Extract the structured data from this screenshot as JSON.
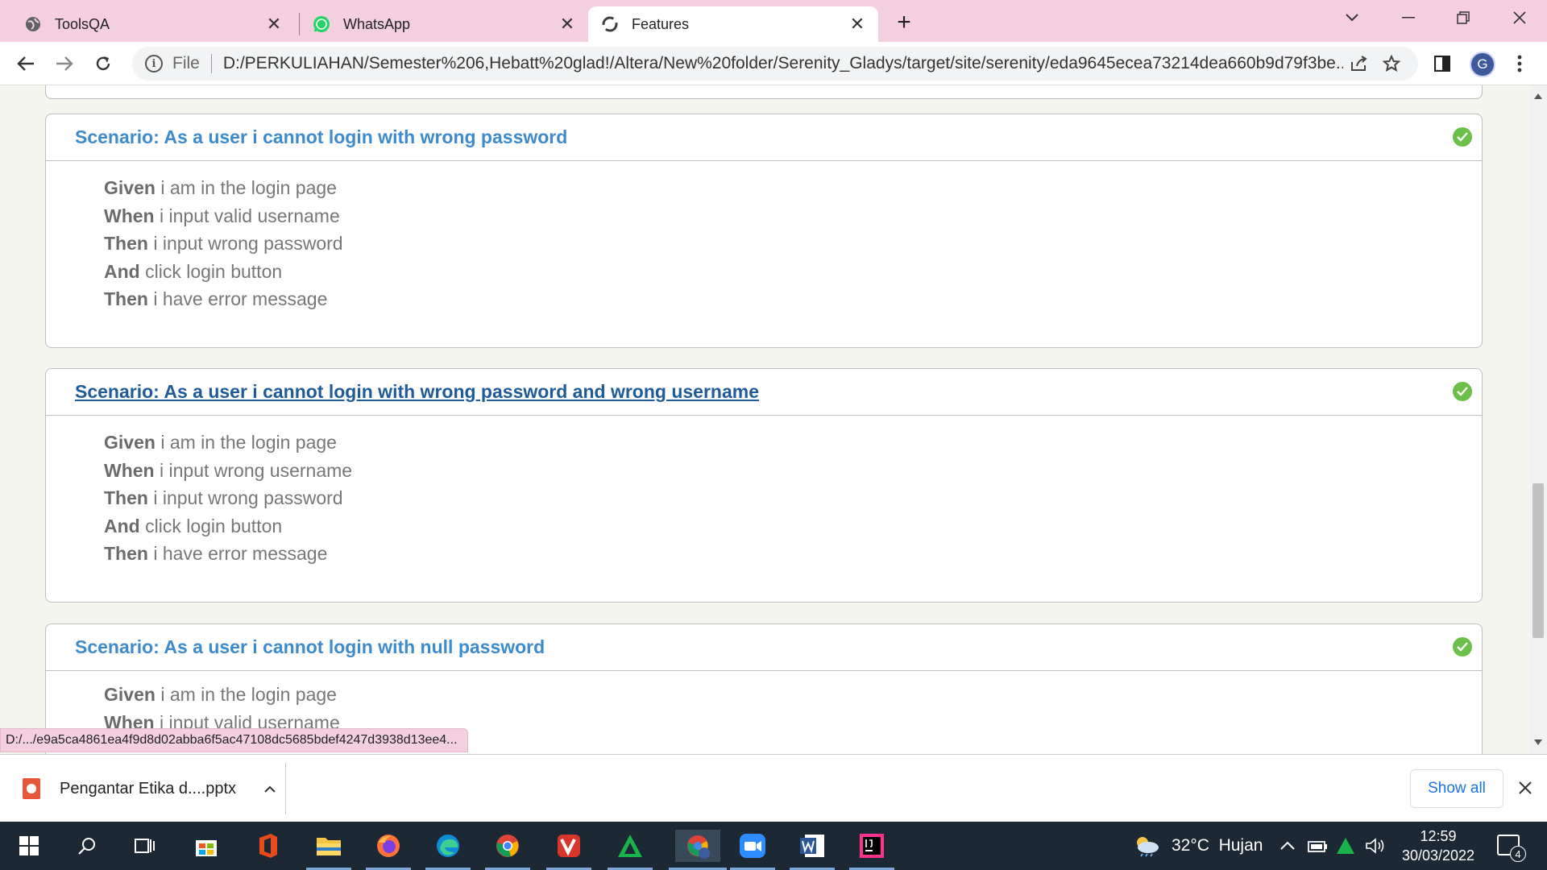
{
  "browser": {
    "tabs": [
      {
        "title": "ToolsQA",
        "icon": "globe-icon"
      },
      {
        "title": "WhatsApp",
        "icon": "whatsapp-icon"
      },
      {
        "title": "Features",
        "icon": "loading-icon",
        "active": true
      }
    ],
    "address": {
      "scheme": "File",
      "url": "D:/PERKULIAHAN/Semester%206,Hebatt%20glad!/Altera/New%20folder/Serenity_Gladys/target/site/serenity/eda9645ecea73214dea660b9d79f3be..."
    },
    "profile_initial": "G",
    "status_url": "D:/.../e9a5ca4861ea4f9d8d02abba6f5ac47108dc5685bdef4247d3938d13ee4..."
  },
  "scenarios": [
    {
      "title": "Scenario: As a user i cannot login with wrong password",
      "status": "passed",
      "steps": [
        {
          "keyword": "Given",
          "text": "i am in the login page"
        },
        {
          "keyword": "When",
          "text": "i input valid username"
        },
        {
          "keyword": "Then",
          "text": "i input wrong password"
        },
        {
          "keyword": "And",
          "text": "click login button"
        },
        {
          "keyword": "Then",
          "text": "i have error message"
        }
      ]
    },
    {
      "title": "Scenario: As a user i cannot login with wrong password and wrong username",
      "status": "passed",
      "steps": [
        {
          "keyword": "Given",
          "text": "i am in the login page"
        },
        {
          "keyword": "When",
          "text": "i input wrong username"
        },
        {
          "keyword": "Then",
          "text": "i input wrong password"
        },
        {
          "keyword": "And",
          "text": "click login button"
        },
        {
          "keyword": "Then",
          "text": "i have error message"
        }
      ]
    },
    {
      "title": "Scenario: As a user i cannot login with null password",
      "status": "passed",
      "steps": [
        {
          "keyword": "Given",
          "text": "i am in the login page"
        },
        {
          "keyword": "When",
          "text": "i input valid username"
        }
      ]
    }
  ],
  "downloads": {
    "file_name": "Pengantar Etika d....pptx",
    "show_all": "Show all"
  },
  "taskbar": {
    "weather": "32°C  Hujan",
    "time": "12:59",
    "date": "30/03/2022",
    "notifications": "4"
  },
  "colors": {
    "tab_strip": "#f4cfe0",
    "scenario_title": "#3d8bcc",
    "passed": "#6cc04a",
    "taskbar": "#1c2833"
  }
}
